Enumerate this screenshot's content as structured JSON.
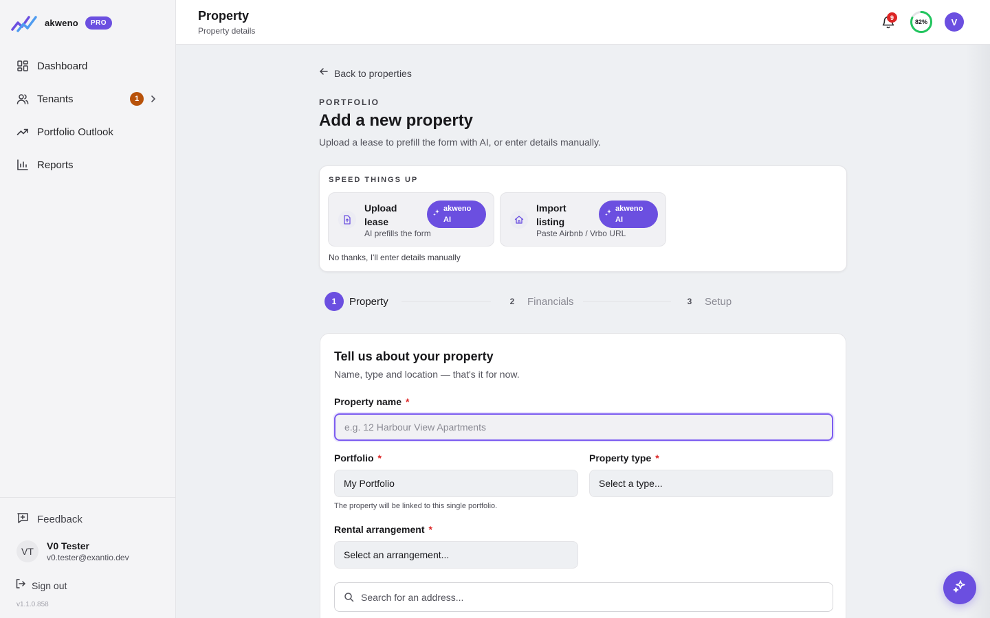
{
  "brand": {
    "name": "akweno",
    "badge": "PRO"
  },
  "sidebar": {
    "items": [
      {
        "label": "Dashboard",
        "icon": "grid-icon"
      },
      {
        "label": "Tenants",
        "icon": "users-icon",
        "badge": "1"
      },
      {
        "label": "Portfolio Outlook",
        "icon": "trending-up-icon"
      },
      {
        "label": "Reports",
        "icon": "bar-chart-icon"
      }
    ],
    "feedback": "Feedback",
    "user": {
      "initials": "VT",
      "name": "V0 Tester",
      "email": "v0.tester@exantio.dev"
    },
    "signout": "Sign out",
    "version": "v1.1.0.858"
  },
  "header": {
    "title": "Property",
    "subtitle": "Property details",
    "notifications": "9",
    "progress_label": "82%",
    "progress_value": 0.82,
    "avatar": "V"
  },
  "main": {
    "back": "Back to properties",
    "eyebrow": "PORTFOLIO",
    "title": "Add a new property",
    "description": "Upload a lease to prefill the form with AI, or enter details manually.",
    "speed": {
      "label": "SPEED THINGS UP",
      "options": [
        {
          "title": "Upload lease",
          "subtitle": "AI prefills the form",
          "pill_line1": "akweno",
          "pill_line2": "AI"
        },
        {
          "title": "Import listing",
          "subtitle": "Paste Airbnb / Vrbo URL",
          "pill_line1": "akweno",
          "pill_line2": "AI"
        }
      ],
      "manual": "No thanks, I'll enter details manually"
    },
    "steps": [
      {
        "num": "1",
        "label": "Property"
      },
      {
        "num": "2",
        "label": "Financials"
      },
      {
        "num": "3",
        "label": "Setup"
      }
    ],
    "form": {
      "title": "Tell us about your property",
      "description": "Name, type and location — that's it for now.",
      "required_mark": "*",
      "property_name": {
        "label": "Property name",
        "placeholder": "e.g. 12 Harbour View Apartments"
      },
      "portfolio": {
        "label": "Portfolio",
        "value": "My Portfolio",
        "hint": "The property will be linked to this single portfolio."
      },
      "property_type": {
        "label": "Property type",
        "value": "Select a type..."
      },
      "rental": {
        "label": "Rental arrangement",
        "value": "Select an arrangement..."
      },
      "address": {
        "placeholder": "Search for an address..."
      }
    }
  },
  "colors": {
    "accent": "#6b4fe0",
    "success": "#22c55e",
    "danger": "#dc2626",
    "badge": "#b8520a"
  }
}
